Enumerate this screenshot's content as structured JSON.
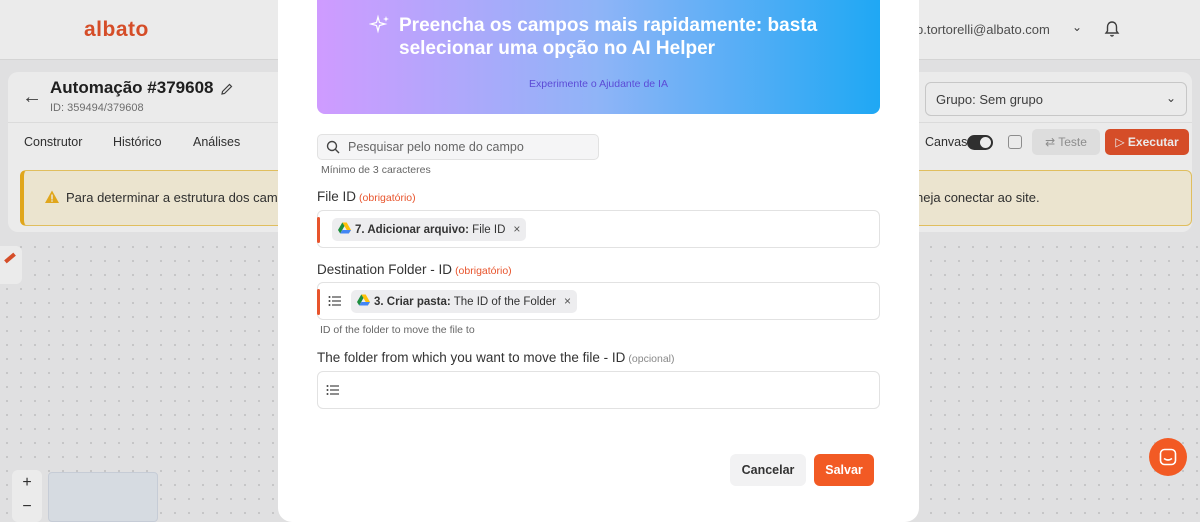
{
  "app": {
    "logo": "albato",
    "user_email": "p.tortorelli@albato.com"
  },
  "automation": {
    "title": "Automação #379608",
    "id_text": "ID: 359494/379608",
    "group_select": "Grupo: Sem grupo"
  },
  "tabs": [
    {
      "label": "Construtor"
    },
    {
      "label": "Histórico"
    },
    {
      "label": "Análises"
    }
  ],
  "toolbar": {
    "canvas_label": "Canvas",
    "test_label": "Teste",
    "run_label": "Executar"
  },
  "warning": {
    "text_left": "Para determinar a estrutura dos camp",
    "text_right": "neja conectar ao site."
  },
  "zoom": {
    "in": "+",
    "out": "−"
  },
  "modal": {
    "ai_banner": {
      "title": "Preencha os campos mais rapidamente: basta selecionar uma opção no AI Helper",
      "link": "Experimente o Ajudante de IA"
    },
    "search": {
      "placeholder": "Pesquisar pelo nome do campo",
      "hint": "Mínimo de 3 caracteres"
    },
    "fields": [
      {
        "label": "File ID",
        "badge": "(obrigatório)",
        "chip_step": "7. Adicionar arquivo:",
        "chip_value": "File ID",
        "chip_remove": "×"
      },
      {
        "label": "Destination Folder - ID",
        "badge": "(obrigatório)",
        "chip_step": "3. Criar pasta:",
        "chip_value": "The ID of the Folder",
        "chip_remove": "×",
        "hint": "ID of the folder to move the file to"
      },
      {
        "label": "The folder from which you want to move the file - ID",
        "badge": "(opcional)"
      }
    ],
    "buttons": {
      "cancel": "Cancelar",
      "save": "Salvar"
    }
  },
  "colors": {
    "brand": "#e8542c",
    "save_button": "#f25a24",
    "ai_gradient_start": "#cf9bff",
    "ai_gradient_end": "#1fa8f4"
  }
}
